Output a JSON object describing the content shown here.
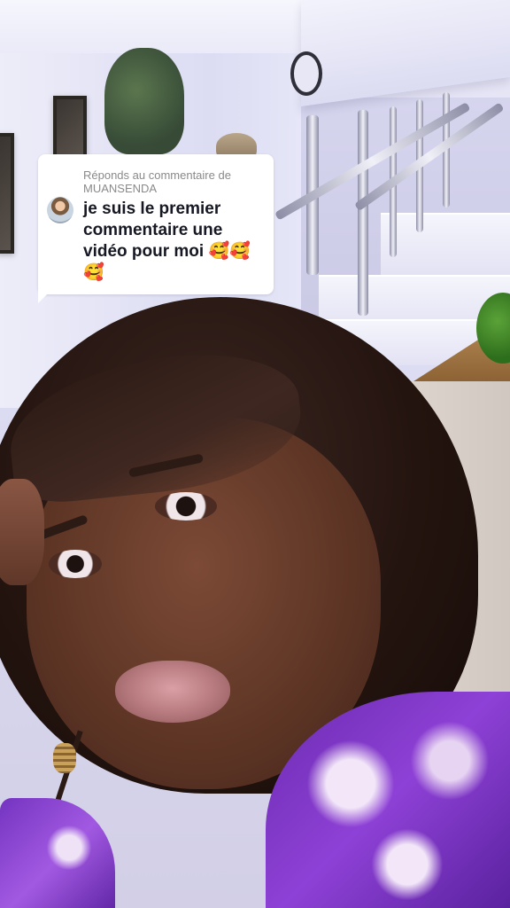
{
  "reply_card": {
    "header_line1": "Réponds au commentaire de",
    "header_line2": "MUANSENDA",
    "comment": "je suis le premier commentaire une vidéo pour moi 🥰🥰🥰",
    "avatar_icon": "user-avatar-icon",
    "background_color": "#ffffff",
    "header_color": "#8a8a8a",
    "text_color": "#161823"
  },
  "video": {
    "subject": "selfie-video-frame"
  }
}
